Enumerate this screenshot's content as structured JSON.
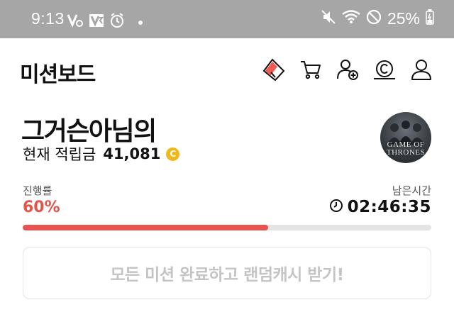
{
  "status_bar": {
    "time": "9:13",
    "battery": "25%",
    "icons_left": [
      "v3-icon",
      "v3-icon",
      "alarm-icon",
      "notification-dot"
    ],
    "icons_right": [
      "mute-icon",
      "wifi-icon",
      "dnd-icon",
      "battery-icon"
    ]
  },
  "app_bar": {
    "title": "미션보드",
    "icons": [
      "ticket-icon",
      "cart-icon",
      "add-friend-icon",
      "cash-icon",
      "profile-icon"
    ]
  },
  "profile": {
    "nickname": "그거슨아님의",
    "balance_label": "현재 적립금",
    "balance_value": "41,081",
    "coin_symbol": "C",
    "avatar_text_line1": "GAME OF",
    "avatar_text_line2": "THRONES"
  },
  "progress": {
    "label": "진행률",
    "value_text": "60%",
    "value": 0.6,
    "time_label": "남은시간",
    "time_value": "02:46:35"
  },
  "cta": {
    "label": "모든 미션 완료하고 랜덤캐시 받기!"
  },
  "colors": {
    "accent": "#e8534f",
    "coin": "#f0b71b",
    "status_bar": "#a6a6a6",
    "disabled_text": "#c4c4c4"
  }
}
